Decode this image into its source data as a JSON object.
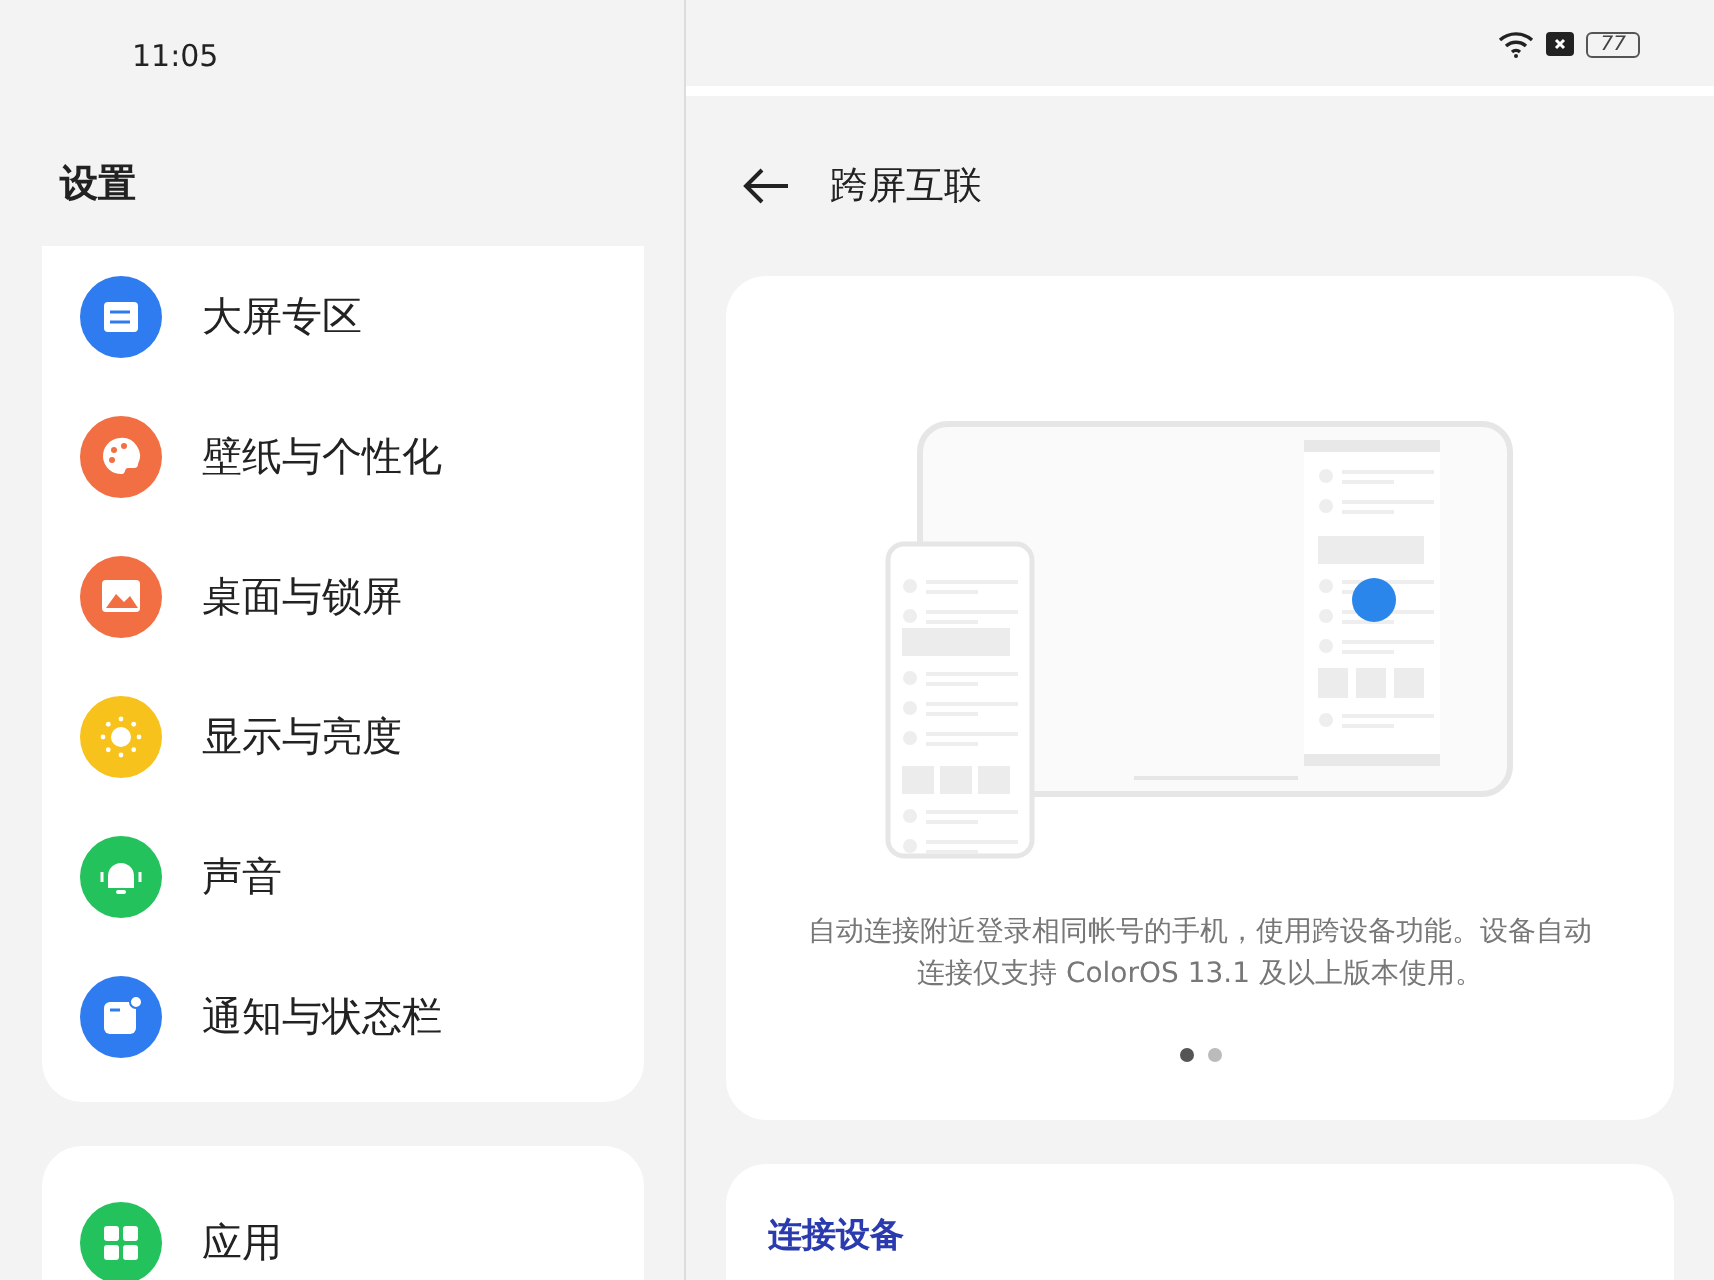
{
  "left_status": {
    "time": "11:05"
  },
  "sidebar": {
    "title": "设置",
    "groups": [
      {
        "items": [
          {
            "label": "大屏专区",
            "color": "#2f7cf0"
          },
          {
            "label": "壁纸与个性化",
            "color": "#f26f44"
          },
          {
            "label": "桌面与锁屏",
            "color": "#f26f44"
          },
          {
            "label": "显示与亮度",
            "color": "#f7c21b"
          },
          {
            "label": "声音",
            "color": "#23c25c"
          },
          {
            "label": "通知与状态栏",
            "color": "#2f7cf0"
          }
        ]
      },
      {
        "items": [
          {
            "label": "应用",
            "color": "#23c25c"
          }
        ]
      }
    ]
  },
  "right_status": {
    "battery": "77"
  },
  "page": {
    "title": "跨屏互联",
    "intro": {
      "description": "自动连接附近登录相同帐号的手机，使用跨设备功能。设备自动连接仅支持 ColorOS 13.1 及以上版本使用。",
      "dots": [
        {
          "selected": true
        },
        {
          "selected": false
        }
      ]
    },
    "section_title": "连接设备"
  }
}
